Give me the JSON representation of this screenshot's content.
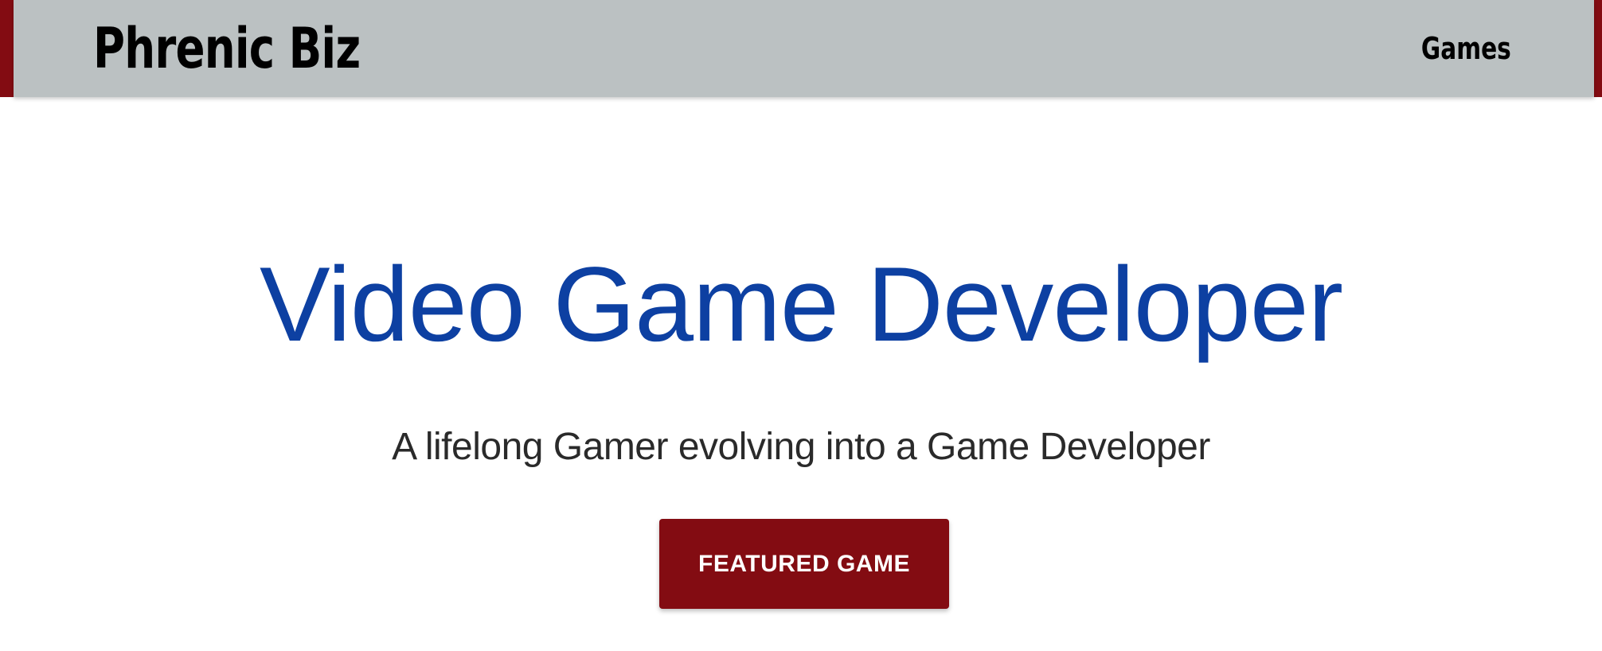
{
  "colors": {
    "accent": "#830c12",
    "navbar_bg": "#bbc1c2",
    "title": "#0d40a2",
    "page_bg": "#ffffff"
  },
  "navbar": {
    "brand": "Phrenic Biz",
    "links": [
      {
        "label": "Games"
      }
    ]
  },
  "hero": {
    "title": "Video Game Developer",
    "subtitle": "A lifelong Gamer evolving into a Game Developer",
    "cta_label": "FEATURED GAME"
  }
}
